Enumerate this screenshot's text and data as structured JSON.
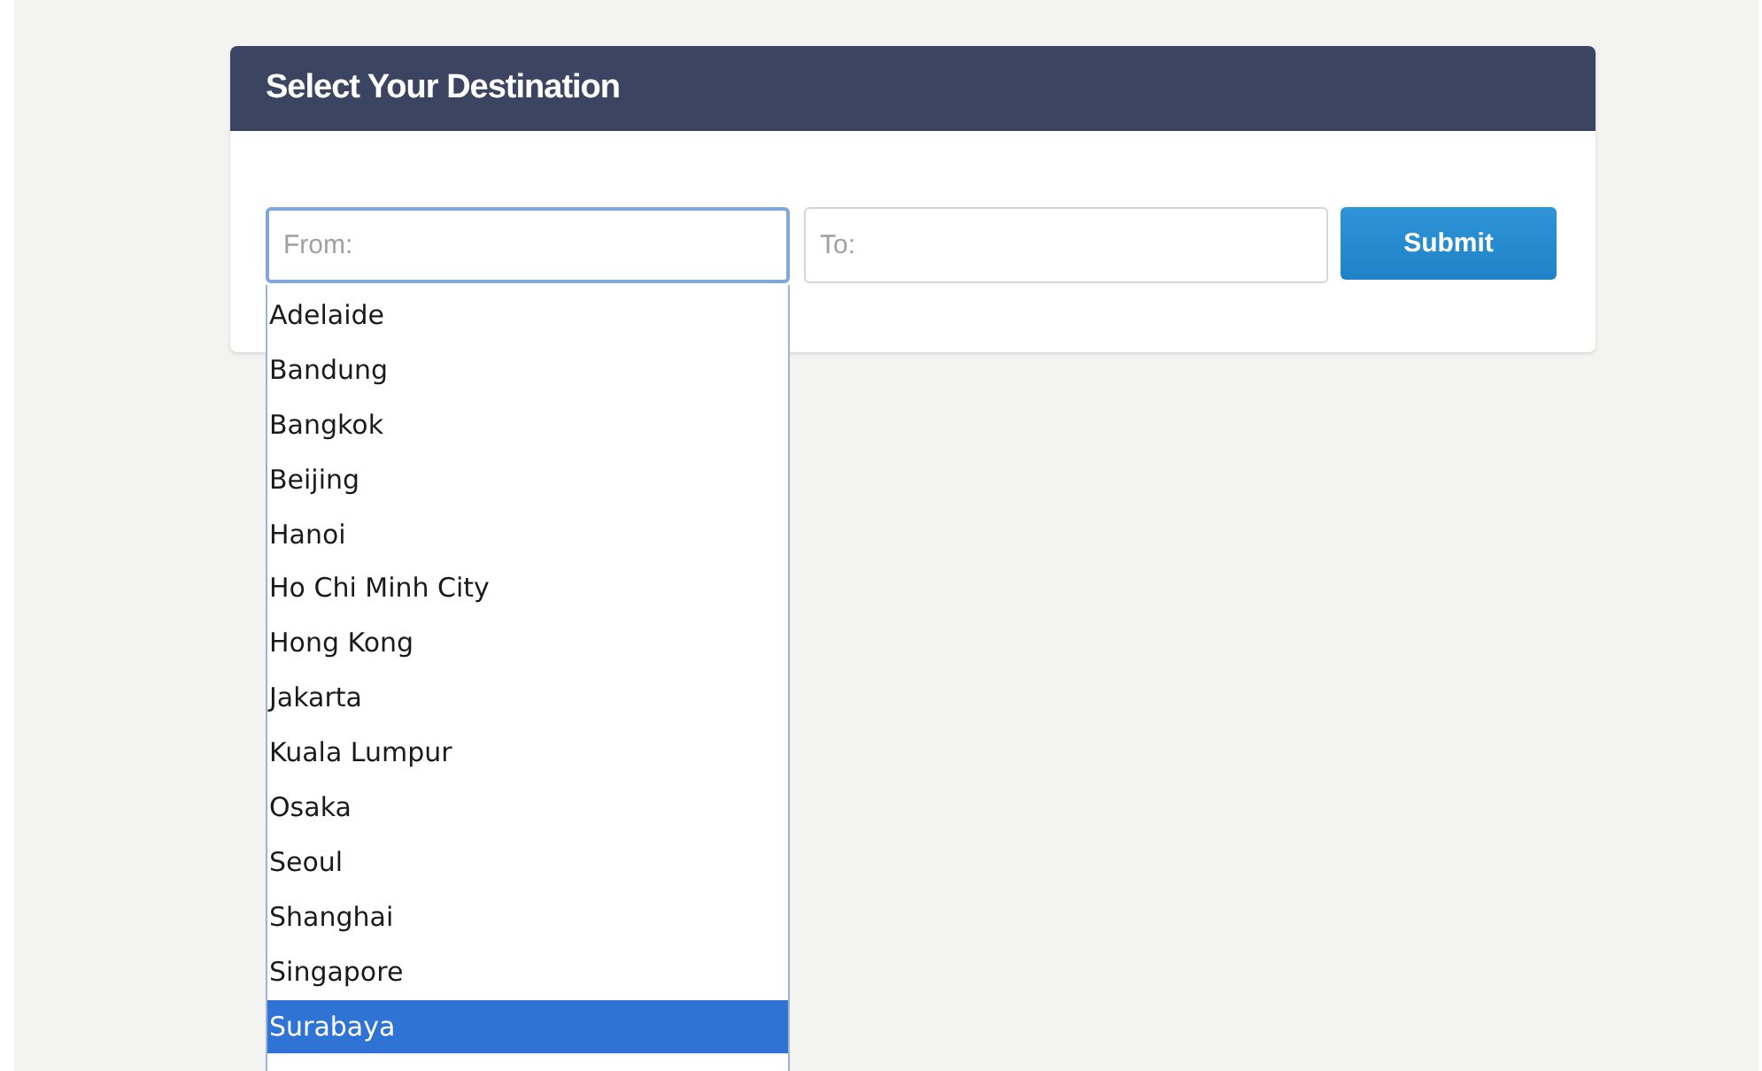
{
  "panel": {
    "title": "Select Your Destination"
  },
  "from_field": {
    "placeholder": "From:",
    "focused": true
  },
  "to_field": {
    "placeholder": "To:"
  },
  "submit_button": {
    "label": "Submit"
  },
  "dropdown": {
    "items": [
      {
        "label": "Adelaide",
        "selected": false
      },
      {
        "label": "Bandung",
        "selected": false
      },
      {
        "label": "Bangkok",
        "selected": false
      },
      {
        "label": "Beijing",
        "selected": false
      },
      {
        "label": "Hanoi",
        "selected": false
      },
      {
        "label": "Ho Chi Minh City",
        "selected": false
      },
      {
        "label": "Hong Kong",
        "selected": false
      },
      {
        "label": "Jakarta",
        "selected": false
      },
      {
        "label": "Kuala Lumpur",
        "selected": false
      },
      {
        "label": "Osaka",
        "selected": false
      },
      {
        "label": "Seoul",
        "selected": false
      },
      {
        "label": "Shanghai",
        "selected": false
      },
      {
        "label": "Singapore",
        "selected": false
      },
      {
        "label": "Surabaya",
        "selected": true
      }
    ]
  }
}
